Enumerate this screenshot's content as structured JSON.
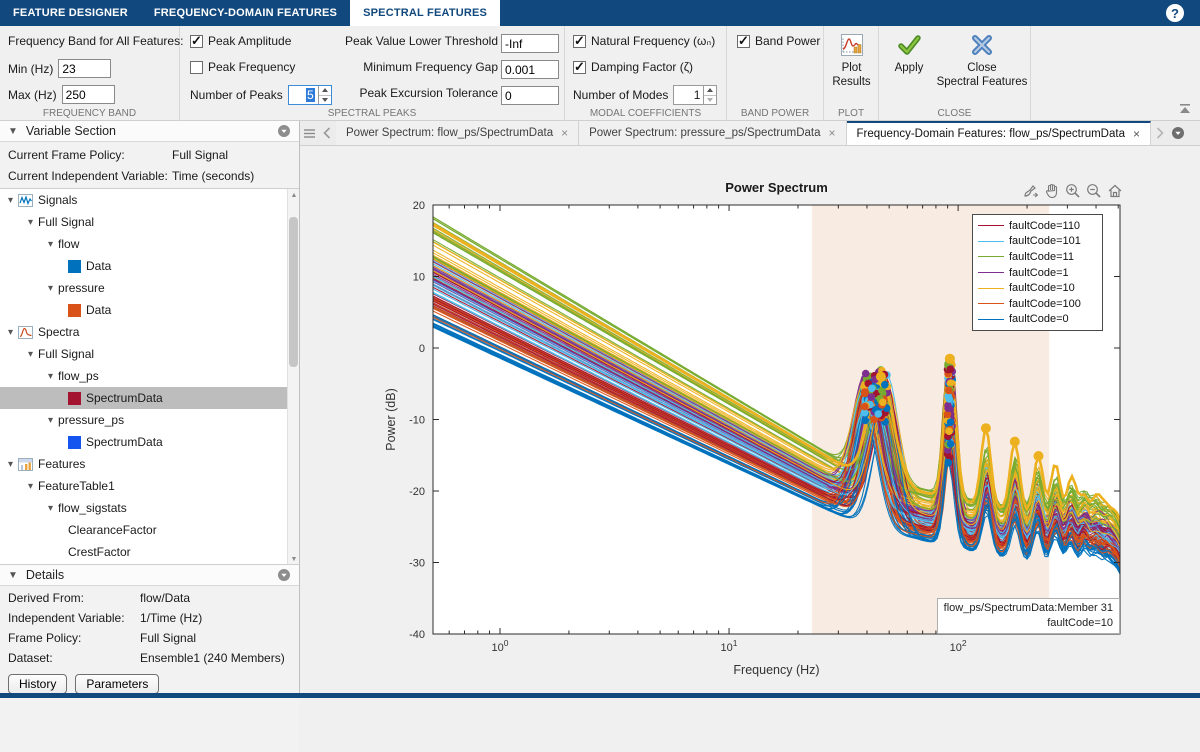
{
  "app": {
    "ribbon_tabs": [
      {
        "label": "FEATURE DESIGNER",
        "active": false
      },
      {
        "label": "FREQUENCY-DOMAIN FEATURES",
        "active": false
      },
      {
        "label": "SPECTRAL FEATURES",
        "active": true
      }
    ],
    "help_label": "?"
  },
  "toolstrip": {
    "frequency_band": {
      "title": "Frequency Band for All Features:",
      "min_label": "Min (Hz)",
      "min_value": "23",
      "max_label": "Max (Hz)",
      "max_value": "250",
      "section": "FREQUENCY BAND"
    },
    "spectral_peaks": {
      "peak_amplitude": {
        "label": "Peak Amplitude",
        "checked": true
      },
      "peak_frequency": {
        "label": "Peak Frequency",
        "checked": false
      },
      "number_of_peaks": {
        "label": "Number of Peaks",
        "value": "5"
      },
      "threshold": {
        "label": "Peak Value Lower Threshold",
        "value": "-Inf"
      },
      "gap": {
        "label": "Minimum Frequency Gap",
        "value": "0.001"
      },
      "excursion": {
        "label": "Peak Excursion Tolerance",
        "value": "0"
      },
      "section": "SPECTRAL PEAKS"
    },
    "modal_coefficients": {
      "natural_frequency": {
        "label": "Natural Frequency (ωₙ)",
        "checked": true
      },
      "damping_factor": {
        "label": "Damping Factor (ζ)",
        "checked": true
      },
      "number_of_modes": {
        "label": "Number of Modes",
        "value": "1"
      },
      "section": "MODAL COEFFICIENTS"
    },
    "band_power": {
      "label": "Band Power",
      "checked": true,
      "section": "BAND POWER"
    },
    "plot": {
      "line1": "Plot",
      "line2": "Results",
      "section": "PLOT"
    },
    "close": {
      "apply_label": "Apply",
      "close_line1": "Close",
      "close_line2": "Spectral Features",
      "section": "CLOSE"
    }
  },
  "left_panel": {
    "variable_section": {
      "title": "Variable Section",
      "frame_policy_label": "Current Frame Policy:",
      "frame_policy_value": "Full Signal",
      "indep_label": "Current Independent Variable:",
      "indep_value": "Time (seconds)"
    },
    "tree": [
      {
        "label": "Signals",
        "depth": 0,
        "icon": "signals",
        "expander": true
      },
      {
        "label": "Full Signal",
        "depth": 1,
        "expander": true
      },
      {
        "label": "flow",
        "depth": 2,
        "expander": true
      },
      {
        "label": "Data",
        "depth": 3,
        "swatch": "#0072BD"
      },
      {
        "label": "pressure",
        "depth": 2,
        "expander": true
      },
      {
        "label": "Data",
        "depth": 3,
        "swatch": "#D95319"
      },
      {
        "label": "Spectra",
        "depth": 0,
        "icon": "spectra",
        "expander": true
      },
      {
        "label": "Full Signal",
        "depth": 1,
        "expander": true
      },
      {
        "label": "flow_ps",
        "depth": 2,
        "expander": true
      },
      {
        "label": "SpectrumData",
        "depth": 3,
        "swatch": "#A2142F",
        "selected": true
      },
      {
        "label": "pressure_ps",
        "depth": 2,
        "expander": true
      },
      {
        "label": "SpectrumData",
        "depth": 3,
        "swatch": "#1455F0"
      },
      {
        "label": "Features",
        "depth": 0,
        "icon": "features",
        "expander": true
      },
      {
        "label": "FeatureTable1",
        "depth": 1,
        "expander": true
      },
      {
        "label": "flow_sigstats",
        "depth": 2,
        "expander": true
      },
      {
        "label": "ClearanceFactor",
        "depth": 3
      },
      {
        "label": "CrestFactor",
        "depth": 3
      }
    ],
    "details": {
      "title": "Details",
      "rows": [
        {
          "k": "Derived From:",
          "v": "flow/Data"
        },
        {
          "k": "Independent Variable:",
          "v": "1/Time (Hz)"
        },
        {
          "k": "Frame Policy:",
          "v": "Full Signal"
        },
        {
          "k": "Dataset:",
          "v": "Ensemble1 (240 Members)"
        }
      ],
      "history_label": "History",
      "parameters_label": "Parameters"
    }
  },
  "doc_tabs": [
    {
      "label": "Power Spectrum: flow_ps/SpectrumData",
      "active": false
    },
    {
      "label": "Power Spectrum: pressure_ps/SpectrumData",
      "active": false
    },
    {
      "label": "Frequency-Domain Features: flow_ps/SpectrumData",
      "active": true
    }
  ],
  "chart_data": {
    "type": "line",
    "title": "Power Spectrum",
    "xlabel": "Frequency (Hz)",
    "ylabel": "Power (dB)",
    "x_scale": "log",
    "xlim": [
      0.51,
      509
    ],
    "ylim": [
      -40,
      20
    ],
    "xticks": [
      1,
      10,
      100
    ],
    "yticks": [
      20,
      10,
      0,
      -10,
      -20,
      -30,
      -40
    ],
    "grid": false,
    "frequency_band_highlight": {
      "min_hz": 23,
      "max_hz": 250,
      "color": "#f8ebe1"
    },
    "legend": {
      "position": "northeast",
      "entries": [
        {
          "label": "faultCode=110",
          "color": "#A2142F"
        },
        {
          "label": "faultCode=101",
          "color": "#4DBEEE"
        },
        {
          "label": "faultCode=11",
          "color": "#77AC30"
        },
        {
          "label": "faultCode=1",
          "color": "#7E2F8E"
        },
        {
          "label": "faultCode=10",
          "color": "#EDB120"
        },
        {
          "label": "faultCode=100",
          "color": "#D95319"
        },
        {
          "label": "faultCode=0",
          "color": "#0072BD"
        }
      ]
    },
    "ensemble": {
      "description": "240-member ensemble of power spectra grouped by faultCode; log-log decaying spectra with resonances and peak markers",
      "groups": [
        {
          "faultCode": "110",
          "color": "#A2142F",
          "level_db_at_0p5hz": [
            6,
            11
          ]
        },
        {
          "faultCode": "101",
          "color": "#4DBEEE",
          "level_db_at_0p5hz": [
            7,
            13.5
          ]
        },
        {
          "faultCode": "11",
          "color": "#77AC30",
          "level_db_at_0p5hz": [
            12,
            18.5
          ]
        },
        {
          "faultCode": "1",
          "color": "#7E2F8E",
          "level_db_at_0p5hz": [
            9,
            13
          ]
        },
        {
          "faultCode": "10",
          "color": "#EDB120",
          "level_db_at_0p5hz": [
            10,
            18
          ]
        },
        {
          "faultCode": "100",
          "color": "#D95319",
          "level_db_at_0p5hz": [
            3.5,
            7.5
          ]
        },
        {
          "faultCode": "0",
          "color": "#0072BD",
          "level_db_at_0p5hz": [
            3,
            6
          ]
        }
      ],
      "resonances_hz": [
        44,
        92
      ],
      "resonance_peak_db": {
        "first": [
          -10,
          -3
        ],
        "second": [
          -15,
          0.3
        ]
      },
      "harmonic_ripples_hz": [
        133,
        178,
        222,
        267,
        311,
        356,
        400,
        445,
        489
      ],
      "peak_markers": true
    },
    "highlighted_member": {
      "label": "flow_ps/SpectrumData:Member 31",
      "faultCode": "10",
      "color": "#EDB120",
      "level_db_at_0p5hz": 17.5,
      "peak1_db": -4,
      "peak2_db": -1.5
    },
    "datatip": {
      "line1": "flow_ps/SpectrumData:Member 31",
      "line2": "faultCode=10"
    },
    "render_hints": {
      "members_per_group": 16,
      "seed": 7
    }
  }
}
